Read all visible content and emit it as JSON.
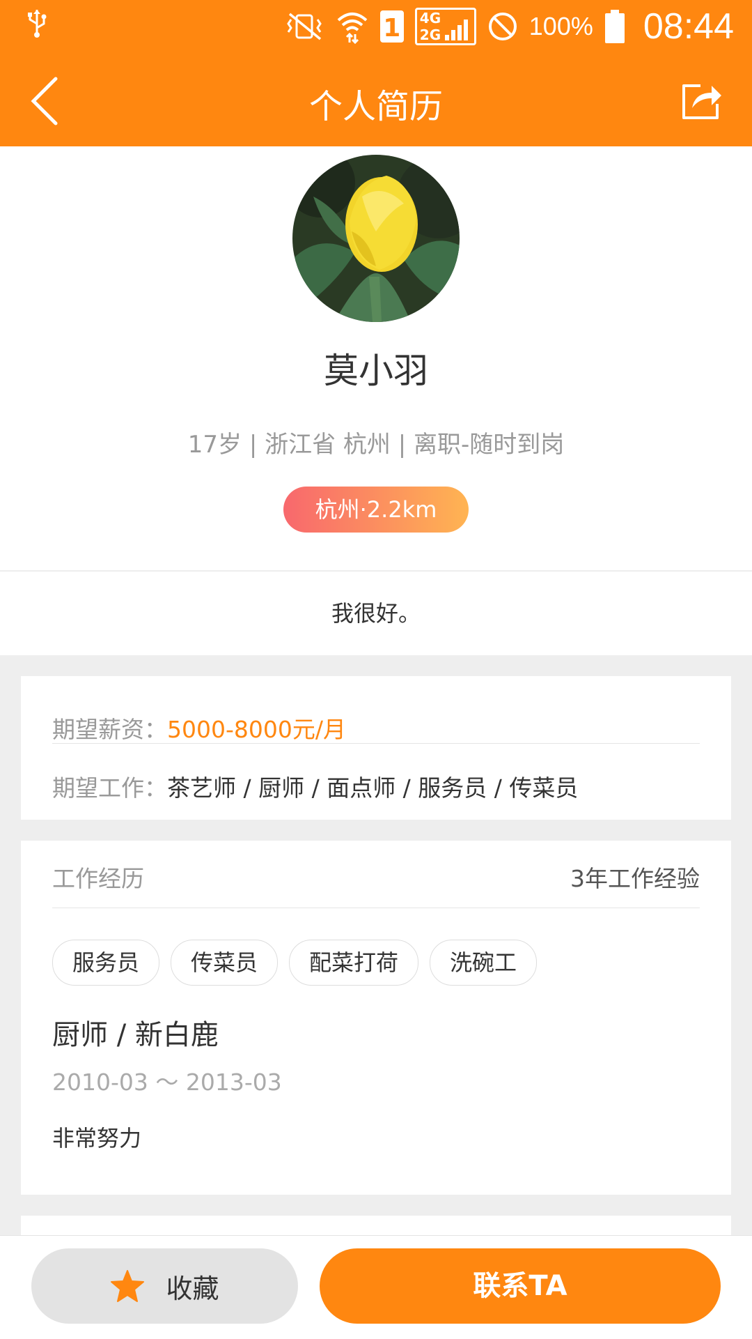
{
  "status_bar": {
    "network_top": "4G",
    "network_bottom": "2G",
    "sim_label": "1",
    "battery_percent": "100%",
    "time": "08:44"
  },
  "header": {
    "title": "个人简历"
  },
  "profile": {
    "name": "莫小羽",
    "meta": "17岁 | 浙江省 杭州 | 离职-随时到岗",
    "location_badge": "杭州·2.2km",
    "intro": "我很好。"
  },
  "expectation": {
    "salary_label": "期望薪资：",
    "salary_value": "5000-8000元/月",
    "job_label": "期望工作：",
    "job_value": "茶艺师 / 厨师 / 面点师 / 服务员 / 传菜员"
  },
  "work": {
    "section_label": "工作经历",
    "experience": "3年工作经验",
    "tags": [
      "服务员",
      "传菜员",
      "配菜打荷",
      "洗碗工"
    ],
    "job_title": "厨师 / 新白鹿",
    "dates": "2010-03 ～ 2013-03",
    "description": "非常努力"
  },
  "bottom_bar": {
    "favorite_label": "收藏",
    "contact_label": "联系TA"
  },
  "colors": {
    "brand": "#ff8710",
    "badge_start": "#f8686d",
    "badge_end": "#ffb452"
  }
}
